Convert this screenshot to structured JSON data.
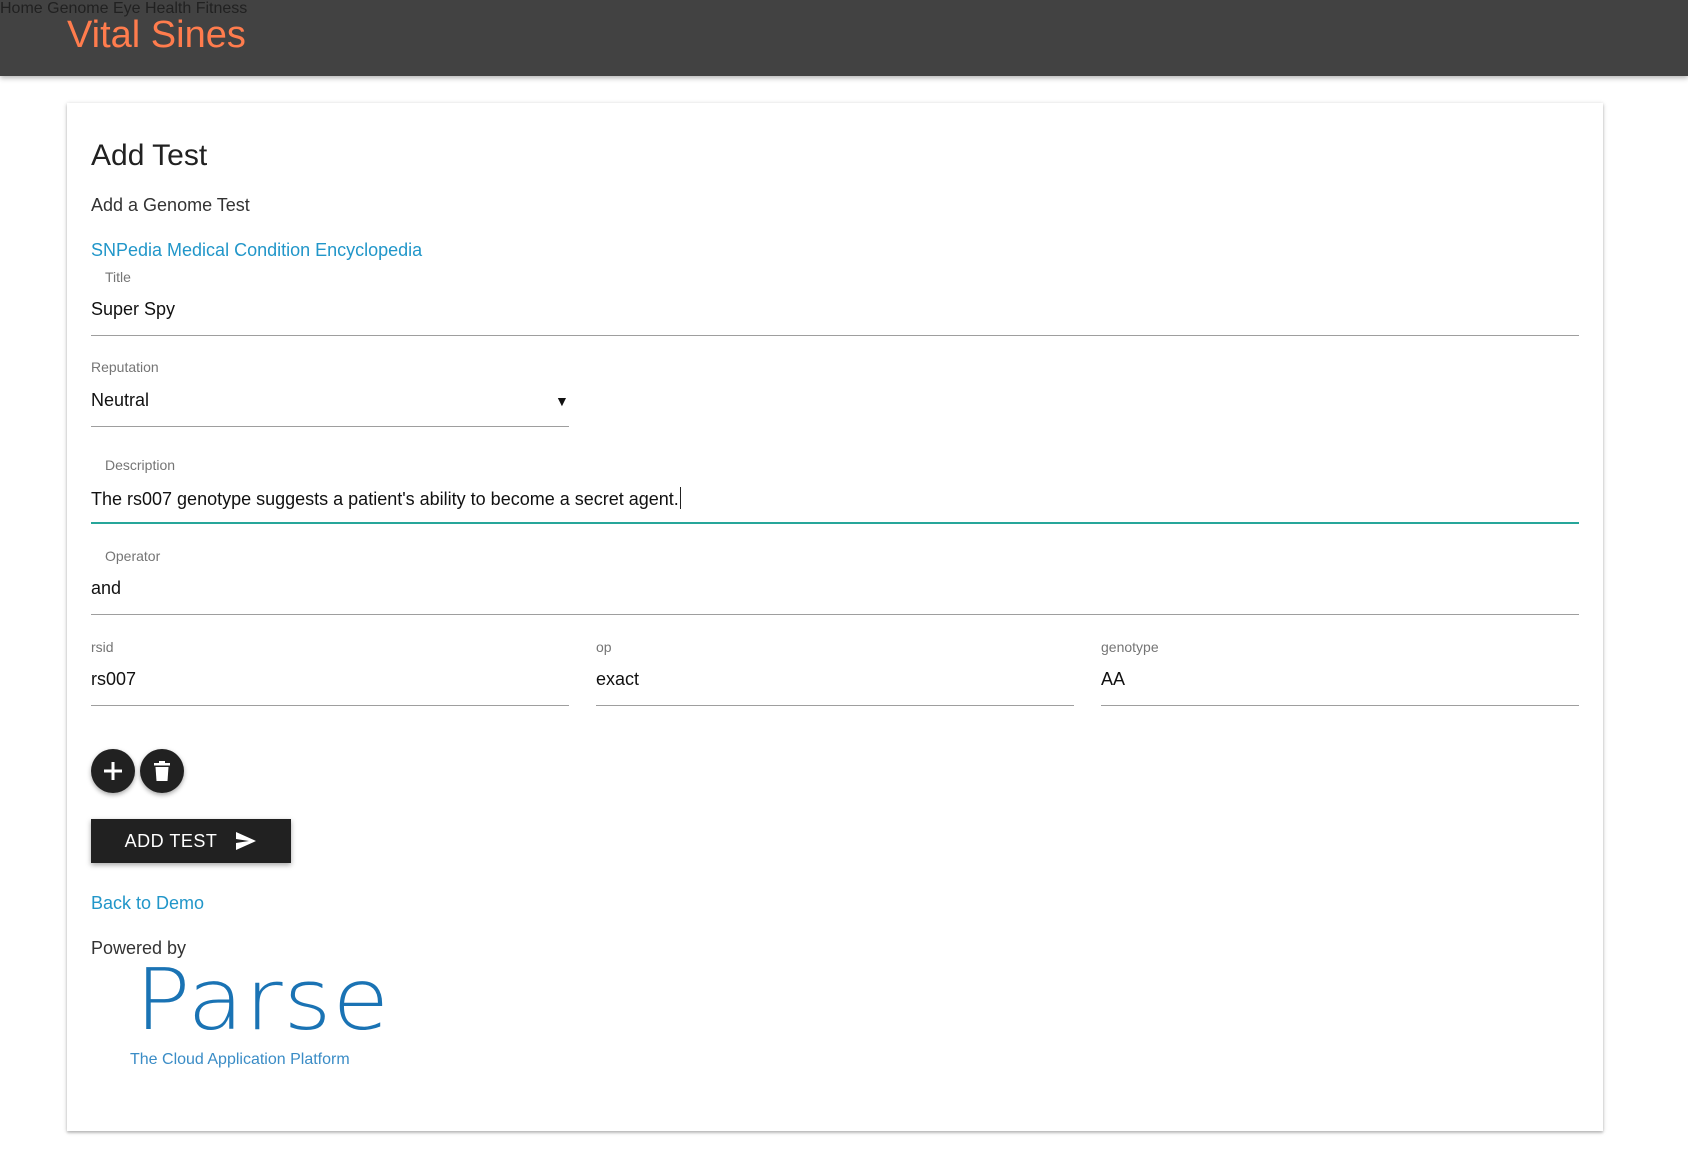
{
  "header": {
    "brand": "Vital Sines",
    "nav": [
      "Home",
      "Genome",
      "Eye Health",
      "Fitness"
    ]
  },
  "form": {
    "heading": "Add Test",
    "subheading": "Add a Genome Test",
    "snpedia_link": "SNPedia Medical Condition Encyclopedia",
    "title": {
      "label": "Title",
      "value": "Super Spy"
    },
    "reputation": {
      "label": "Reputation",
      "value": "Neutral"
    },
    "description": {
      "label": "Description",
      "value": "The rs007 genotype suggests a patient's ability to become a secret agent."
    },
    "operator": {
      "label": "Operator",
      "value": "and"
    },
    "rsid": {
      "label": "rsid",
      "value": "rs007"
    },
    "op": {
      "label": "op",
      "value": "exact"
    },
    "genotype": {
      "label": "genotype",
      "value": "AA"
    },
    "submit_label": "ADD TEST"
  },
  "footer": {
    "back_link": "Back to Demo",
    "powered_by": "Powered by",
    "logo_tagline": "The Cloud Application Platform"
  },
  "colors": {
    "brand": "#ff7c4d",
    "header_bg": "#424242",
    "link": "#2196c9",
    "focus_underline": "#26a69a",
    "button_bg": "#212121"
  },
  "icons": {
    "add": "plus-icon",
    "delete": "trash-icon",
    "submit": "send-icon",
    "dropdown": "caret-down-icon"
  }
}
